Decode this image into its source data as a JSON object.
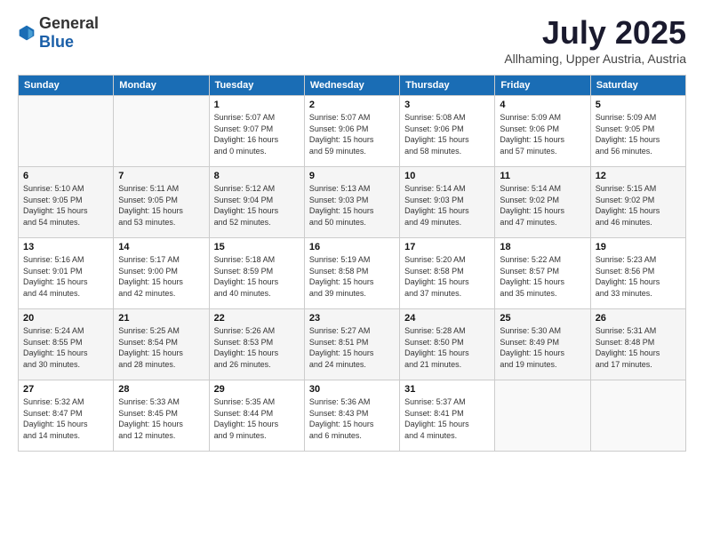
{
  "header": {
    "logo_general": "General",
    "logo_blue": "Blue",
    "month_title": "July 2025",
    "location": "Allhaming, Upper Austria, Austria"
  },
  "weekdays": [
    "Sunday",
    "Monday",
    "Tuesday",
    "Wednesday",
    "Thursday",
    "Friday",
    "Saturday"
  ],
  "weeks": [
    [
      {
        "day": "",
        "info": ""
      },
      {
        "day": "",
        "info": ""
      },
      {
        "day": "1",
        "info": "Sunrise: 5:07 AM\nSunset: 9:07 PM\nDaylight: 16 hours\nand 0 minutes."
      },
      {
        "day": "2",
        "info": "Sunrise: 5:07 AM\nSunset: 9:06 PM\nDaylight: 15 hours\nand 59 minutes."
      },
      {
        "day": "3",
        "info": "Sunrise: 5:08 AM\nSunset: 9:06 PM\nDaylight: 15 hours\nand 58 minutes."
      },
      {
        "day": "4",
        "info": "Sunrise: 5:09 AM\nSunset: 9:06 PM\nDaylight: 15 hours\nand 57 minutes."
      },
      {
        "day": "5",
        "info": "Sunrise: 5:09 AM\nSunset: 9:05 PM\nDaylight: 15 hours\nand 56 minutes."
      }
    ],
    [
      {
        "day": "6",
        "info": "Sunrise: 5:10 AM\nSunset: 9:05 PM\nDaylight: 15 hours\nand 54 minutes."
      },
      {
        "day": "7",
        "info": "Sunrise: 5:11 AM\nSunset: 9:05 PM\nDaylight: 15 hours\nand 53 minutes."
      },
      {
        "day": "8",
        "info": "Sunrise: 5:12 AM\nSunset: 9:04 PM\nDaylight: 15 hours\nand 52 minutes."
      },
      {
        "day": "9",
        "info": "Sunrise: 5:13 AM\nSunset: 9:03 PM\nDaylight: 15 hours\nand 50 minutes."
      },
      {
        "day": "10",
        "info": "Sunrise: 5:14 AM\nSunset: 9:03 PM\nDaylight: 15 hours\nand 49 minutes."
      },
      {
        "day": "11",
        "info": "Sunrise: 5:14 AM\nSunset: 9:02 PM\nDaylight: 15 hours\nand 47 minutes."
      },
      {
        "day": "12",
        "info": "Sunrise: 5:15 AM\nSunset: 9:02 PM\nDaylight: 15 hours\nand 46 minutes."
      }
    ],
    [
      {
        "day": "13",
        "info": "Sunrise: 5:16 AM\nSunset: 9:01 PM\nDaylight: 15 hours\nand 44 minutes."
      },
      {
        "day": "14",
        "info": "Sunrise: 5:17 AM\nSunset: 9:00 PM\nDaylight: 15 hours\nand 42 minutes."
      },
      {
        "day": "15",
        "info": "Sunrise: 5:18 AM\nSunset: 8:59 PM\nDaylight: 15 hours\nand 40 minutes."
      },
      {
        "day": "16",
        "info": "Sunrise: 5:19 AM\nSunset: 8:58 PM\nDaylight: 15 hours\nand 39 minutes."
      },
      {
        "day": "17",
        "info": "Sunrise: 5:20 AM\nSunset: 8:58 PM\nDaylight: 15 hours\nand 37 minutes."
      },
      {
        "day": "18",
        "info": "Sunrise: 5:22 AM\nSunset: 8:57 PM\nDaylight: 15 hours\nand 35 minutes."
      },
      {
        "day": "19",
        "info": "Sunrise: 5:23 AM\nSunset: 8:56 PM\nDaylight: 15 hours\nand 33 minutes."
      }
    ],
    [
      {
        "day": "20",
        "info": "Sunrise: 5:24 AM\nSunset: 8:55 PM\nDaylight: 15 hours\nand 30 minutes."
      },
      {
        "day": "21",
        "info": "Sunrise: 5:25 AM\nSunset: 8:54 PM\nDaylight: 15 hours\nand 28 minutes."
      },
      {
        "day": "22",
        "info": "Sunrise: 5:26 AM\nSunset: 8:53 PM\nDaylight: 15 hours\nand 26 minutes."
      },
      {
        "day": "23",
        "info": "Sunrise: 5:27 AM\nSunset: 8:51 PM\nDaylight: 15 hours\nand 24 minutes."
      },
      {
        "day": "24",
        "info": "Sunrise: 5:28 AM\nSunset: 8:50 PM\nDaylight: 15 hours\nand 21 minutes."
      },
      {
        "day": "25",
        "info": "Sunrise: 5:30 AM\nSunset: 8:49 PM\nDaylight: 15 hours\nand 19 minutes."
      },
      {
        "day": "26",
        "info": "Sunrise: 5:31 AM\nSunset: 8:48 PM\nDaylight: 15 hours\nand 17 minutes."
      }
    ],
    [
      {
        "day": "27",
        "info": "Sunrise: 5:32 AM\nSunset: 8:47 PM\nDaylight: 15 hours\nand 14 minutes."
      },
      {
        "day": "28",
        "info": "Sunrise: 5:33 AM\nSunset: 8:45 PM\nDaylight: 15 hours\nand 12 minutes."
      },
      {
        "day": "29",
        "info": "Sunrise: 5:35 AM\nSunset: 8:44 PM\nDaylight: 15 hours\nand 9 minutes."
      },
      {
        "day": "30",
        "info": "Sunrise: 5:36 AM\nSunset: 8:43 PM\nDaylight: 15 hours\nand 6 minutes."
      },
      {
        "day": "31",
        "info": "Sunrise: 5:37 AM\nSunset: 8:41 PM\nDaylight: 15 hours\nand 4 minutes."
      },
      {
        "day": "",
        "info": ""
      },
      {
        "day": "",
        "info": ""
      }
    ]
  ]
}
